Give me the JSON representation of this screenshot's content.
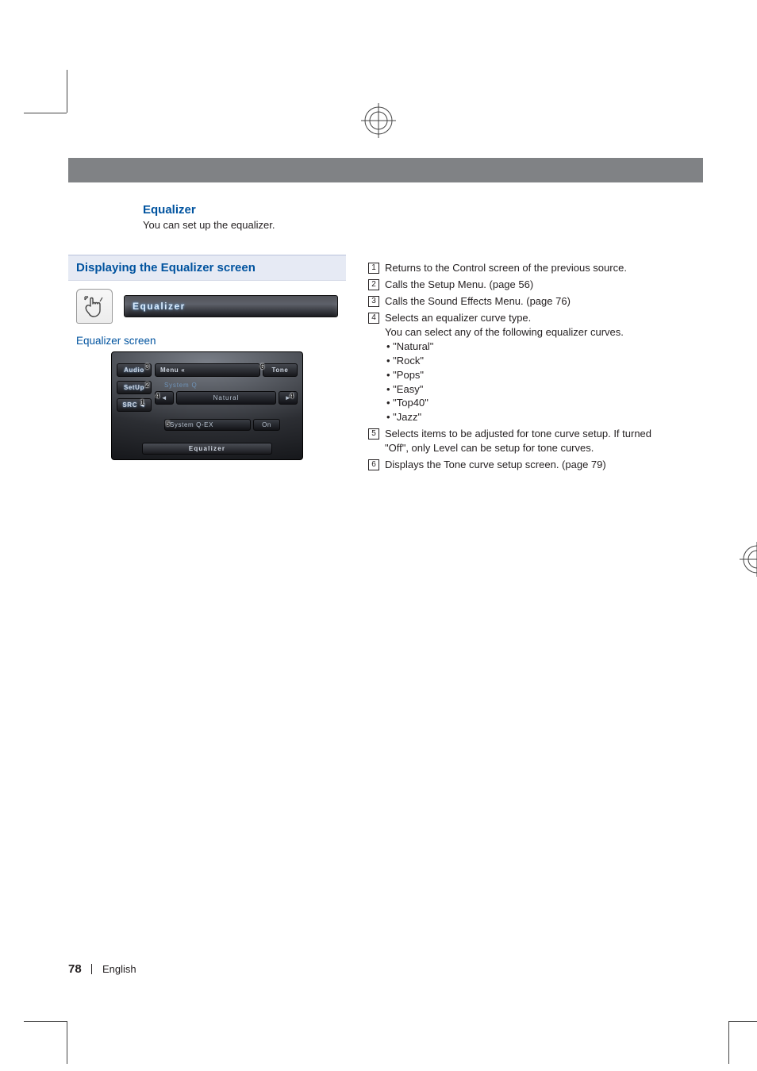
{
  "section": {
    "title": "Equalizer",
    "subtitle": "You can set up the equalizer."
  },
  "box": {
    "heading": "Displaying the Equalizer screen",
    "button_label": "Equalizer",
    "screen_label": "Equalizer screen"
  },
  "screen": {
    "side": {
      "audio": "Audio",
      "setup": "SetUp",
      "src": "SRC"
    },
    "topbar": {
      "menu": "Menu",
      "menu_arrows": "«",
      "tone": "Tone"
    },
    "row1_label": "System Q",
    "midbar": {
      "left_arrow": "◄",
      "value": "Natural",
      "right_arrow": "►"
    },
    "qex": {
      "label": "System Q-EX",
      "value": "On"
    },
    "footer": "Equalizer",
    "cursors": {
      "c1": "1",
      "c2": "2",
      "c3": "3",
      "c4_left": "4",
      "c4_right": "4",
      "c5": "5",
      "c6": "6"
    }
  },
  "descriptions": [
    {
      "n": "1",
      "lines": [
        "Returns to the Control screen of the previous source."
      ]
    },
    {
      "n": "2",
      "lines": [
        "Calls the Setup Menu. (page 56)"
      ]
    },
    {
      "n": "3",
      "lines": [
        "Calls the Sound Effects Menu. (page 76)"
      ]
    },
    {
      "n": "4",
      "lines": [
        "Selects an equalizer curve type.",
        "You can select any of the following equalizer curves."
      ],
      "bullets": [
        "\"Natural\"",
        "\"Rock\"",
        "\"Pops\"",
        "\"Easy\"",
        "\"Top40\"",
        "\"Jazz\""
      ]
    },
    {
      "n": "5",
      "lines": [
        "Selects items to be adjusted for tone curve setup. If turned \"Off\", only Level can be setup for tone curves."
      ]
    },
    {
      "n": "6",
      "lines": [
        "Displays the Tone curve setup screen. (page 79)"
      ]
    }
  ],
  "footer": {
    "page": "78",
    "lang": "English"
  }
}
